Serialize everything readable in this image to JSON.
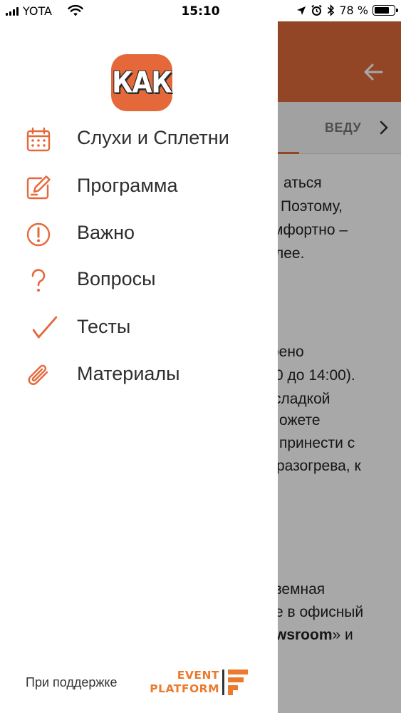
{
  "status_bar": {
    "carrier": "YOTA",
    "time": "15:10",
    "battery_percent_label": "78 %",
    "battery_level": 0.78
  },
  "drawer": {
    "logo_text": "КАК",
    "menu": [
      {
        "id": "rumors",
        "label": "Слухи и Сплетни",
        "icon": "calendar-icon"
      },
      {
        "id": "program",
        "label": "Программа",
        "icon": "edit-note-icon"
      },
      {
        "id": "important",
        "label": "Важно",
        "icon": "exclamation-circle-icon"
      },
      {
        "id": "questions",
        "label": "Вопросы",
        "icon": "question-icon"
      },
      {
        "id": "tests",
        "label": "Тесты",
        "icon": "checkmark-icon"
      },
      {
        "id": "materials",
        "label": "Материалы",
        "icon": "paperclip-icon"
      }
    ],
    "sponsor_text": "При поддержке",
    "sponsor_brand_line1": "EVENT",
    "sponsor_brand_line2": "PLATFORM"
  },
  "background": {
    "tab_label": "ВЕДУ",
    "content_lines": [
      "аться",
      "Поэтому,",
      "мфортно –",
      "лее.",
      "рено",
      "0 до 14:00).",
      "сладкой",
      "ожете",
      "принести с",
      "разогрева, к",
      "земная",
      "е в офисный",
      "wsroom",
      "» и"
    ]
  },
  "colors": {
    "accent": "#e5683a",
    "appbar": "#de6b3a",
    "sponsor": "#ec7a2c"
  }
}
